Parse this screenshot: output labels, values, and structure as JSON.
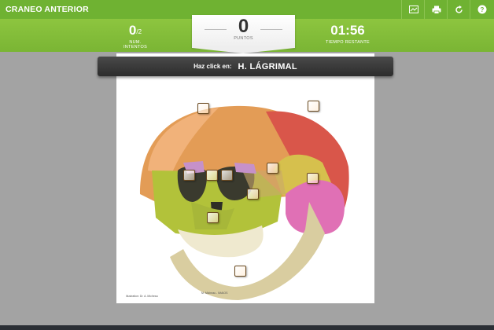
{
  "header": {
    "title": "CRANEO ANTERIOR",
    "toolbar_icons": [
      "slideshow-icon",
      "print-icon",
      "restart-icon",
      "help-icon"
    ]
  },
  "stats": {
    "attempts_value": "0",
    "attempts_total": "/2",
    "attempts_label": "NUM. INTENTOS",
    "points_value": "0",
    "points_label": "PUNTOS",
    "time_value": "01:56",
    "time_label": "TIEMPO RESTANTE"
  },
  "prompt": {
    "prefix": "Haz click en:",
    "target": "H. LÁGRIMAL"
  },
  "credits": {
    "illustrator": "Illustration: Dr. A. Micheau",
    "copyright": "M. Micheau - IMAIOS"
  },
  "colors": {
    "primary_green": "#7ab534",
    "banner_dark": "#333333",
    "background": "#a3a3a3"
  }
}
